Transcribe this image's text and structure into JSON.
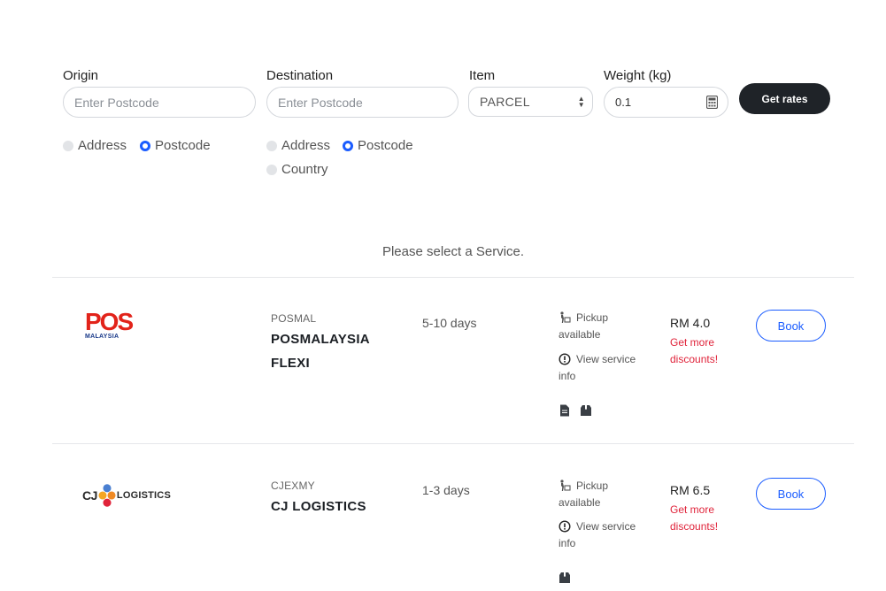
{
  "form": {
    "origin": {
      "label": "Origin",
      "placeholder": "Enter Postcode",
      "options": [
        "Address",
        "Postcode"
      ],
      "selected": "Postcode"
    },
    "destination": {
      "label": "Destination",
      "placeholder": "Enter Postcode",
      "options": [
        "Address",
        "Postcode",
        "Country"
      ],
      "selected": "Postcode"
    },
    "item": {
      "label": "Item",
      "value": "PARCEL"
    },
    "weight": {
      "label": "Weight (kg)",
      "value": "0.1"
    },
    "get_rates_label": "Get rates"
  },
  "message": "Please select a Service.",
  "services": [
    {
      "code": "POSMAL",
      "name_line1": "POSMALAYSIA",
      "name_line2": "FLEXI",
      "days": "5-10 days",
      "pickup_line1": "Pickup",
      "pickup_line2": "available",
      "info_line1": "View service",
      "info_line2": "info",
      "price": "RM 4.0",
      "discount_line1": "Get more",
      "discount_line2": "discounts!",
      "book_label": "Book",
      "logo_text": "POS",
      "logo_sub": "MALAYSIA"
    },
    {
      "code": "CJEXMY",
      "name_line1": "CJ LOGISTICS",
      "days": "1-3 days",
      "pickup_line1": "Pickup",
      "pickup_line2": "available",
      "info_line1": "View service",
      "info_line2": "info",
      "price": "RM 6.5",
      "discount_line1": "Get more",
      "discount_line2": "discounts!",
      "book_label": "Book",
      "logo_cj": "CJ",
      "logo_text": "LOGISTICS"
    }
  ],
  "colors": {
    "accent": "#1a5cff",
    "dark_button": "#1f2328",
    "discount": "#e0233a",
    "pos_red": "#e2231a"
  }
}
